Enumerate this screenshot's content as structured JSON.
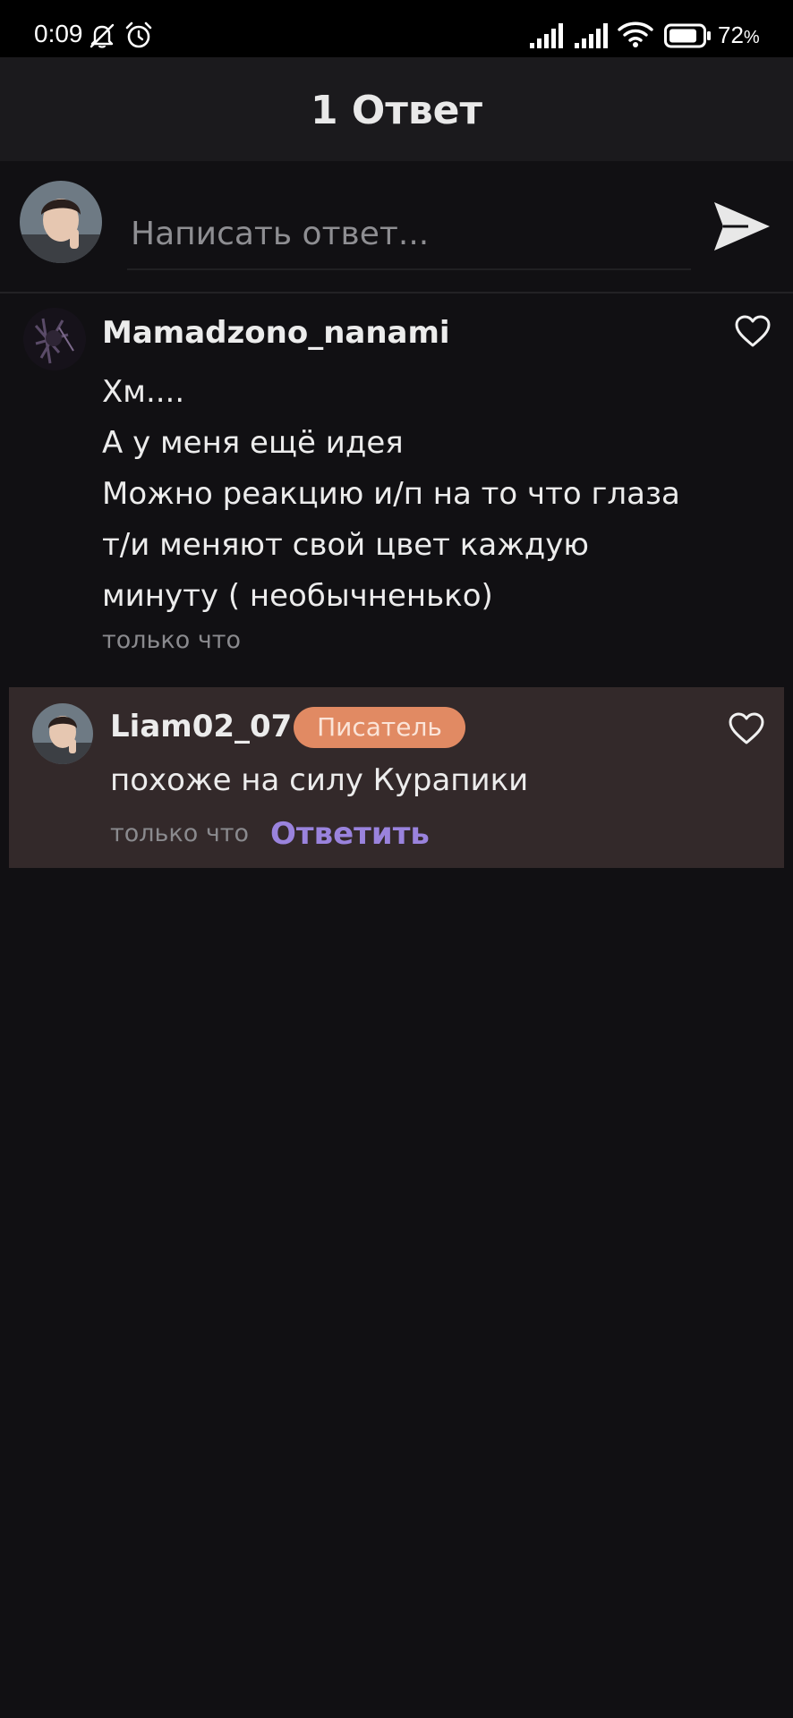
{
  "status_bar": {
    "time": "0:09",
    "battery_percent": "72",
    "battery_unit": "%"
  },
  "header": {
    "title": "1 Ответ"
  },
  "reply_box": {
    "placeholder": "Написать ответ..."
  },
  "comment": {
    "username": "Mamadzono_nanami",
    "lines": [
      "Хм....",
      "А у меня ещё идея",
      "Можно реакцию и/п на то что глаза",
      "т/и меняют свой цвет каждую",
      "минуту ( необычненько)"
    ],
    "time": "только что"
  },
  "reply": {
    "username": "Liam02_07",
    "badge": "Писатель",
    "text": "похоже на силу Курапики",
    "time": "только что",
    "action": "Ответить"
  },
  "colors": {
    "background": "#111013",
    "header": "#1b1a1d",
    "reply_highlight": "#33292a",
    "badge": "#e18a63",
    "accent": "#9a83dd"
  }
}
